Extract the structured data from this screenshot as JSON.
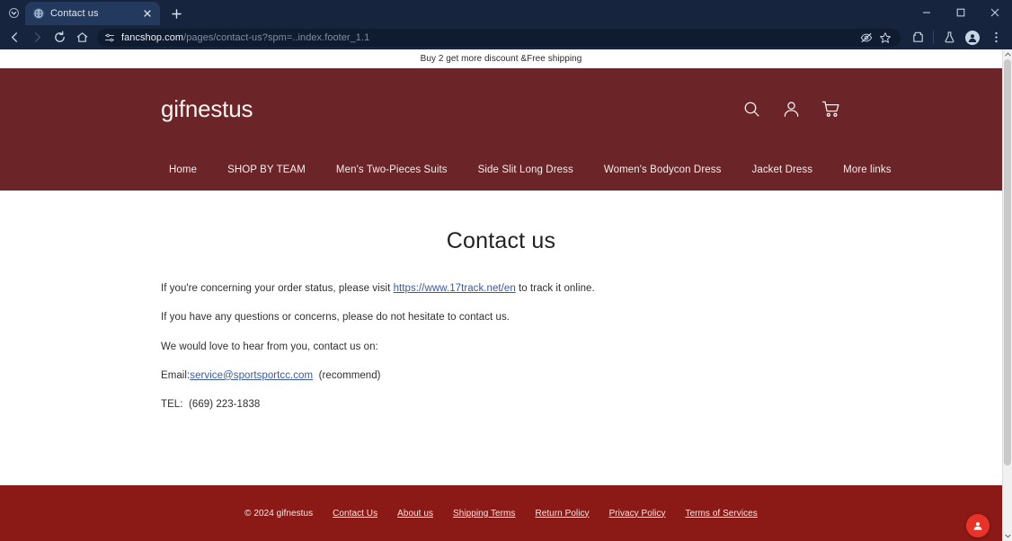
{
  "browser": {
    "tab": {
      "title": "Contact us",
      "favicon_icon": "globe-icon",
      "close_icon": "close-icon"
    },
    "new_tab_label": "+",
    "tab_list_icon": "chevron-down-icon",
    "window_controls": {
      "minimize_icon": "minimize-icon",
      "maximize_icon": "maximize-icon",
      "close_icon": "close-icon"
    },
    "toolbar": {
      "back_icon": "back-arrow-icon",
      "forward_icon": "forward-arrow-icon",
      "reload_icon": "reload-icon",
      "home_icon": "home-icon",
      "site_info_icon": "site-settings-icon",
      "url_domain": "fancshop.com",
      "url_path": "/pages/contact-us?spm=..index.footer_1.1",
      "tracking_protection_icon": "eye-slash-icon",
      "bookmark_icon": "star-icon",
      "extensions_icon": "extensions-puzzle-icon",
      "labs_icon": "flask-icon",
      "profile_icon": "profile-avatar-icon",
      "menu_icon": "three-dot-menu-icon"
    },
    "scrollbar": {
      "up_icon": "scroll-up-arrow-icon",
      "down_icon": "scroll-down-arrow-icon"
    }
  },
  "site": {
    "announcement": "Buy 2 get more discount &Free shipping",
    "brand": "gifnestus",
    "header_icons": [
      {
        "name": "search-icon",
        "label": "Search"
      },
      {
        "name": "account-icon",
        "label": "Account"
      },
      {
        "name": "cart-icon",
        "label": "Cart"
      }
    ],
    "nav": [
      {
        "label": "Home"
      },
      {
        "label": "SHOP BY TEAM"
      },
      {
        "label": "Men's Two-Pieces Suits"
      },
      {
        "label": "Side Slit Long Dress"
      },
      {
        "label": "Women's Bodycon Dress"
      },
      {
        "label": "Jacket Dress"
      },
      {
        "label": "More links"
      }
    ],
    "colors": {
      "header_bg": "#6b2428",
      "footer_bg": "#8b1a16",
      "link": "#3a5a9b",
      "chat_widget": "#e8332a"
    }
  },
  "main": {
    "title": "Contact us",
    "paragraph_1": {
      "before": "If you're concerning your order status, please visit ",
      "link": "https://www.17track.net/en",
      "after": " to track it online."
    },
    "paragraph_2": "If you have any questions or concerns, please do not hesitate to contact us.",
    "paragraph_3": "We would love to hear from you, contact us on:",
    "email_row": {
      "label": "Email:",
      "email": "service@sportsportcc.com",
      "note": "(recommend)"
    },
    "tel_row": {
      "label": "TEL:",
      "number": "(669) 223-1838"
    }
  },
  "footer": {
    "copyright": "© 2024 gifnestus",
    "links": [
      {
        "label": "Contact Us"
      },
      {
        "label": "About us"
      },
      {
        "label": "Shipping Terms"
      },
      {
        "label": "Return Policy"
      },
      {
        "label": "Privacy Policy"
      },
      {
        "label": "Terms of Services"
      }
    ]
  },
  "chat_widget": {
    "icon": "support-chat-icon"
  }
}
